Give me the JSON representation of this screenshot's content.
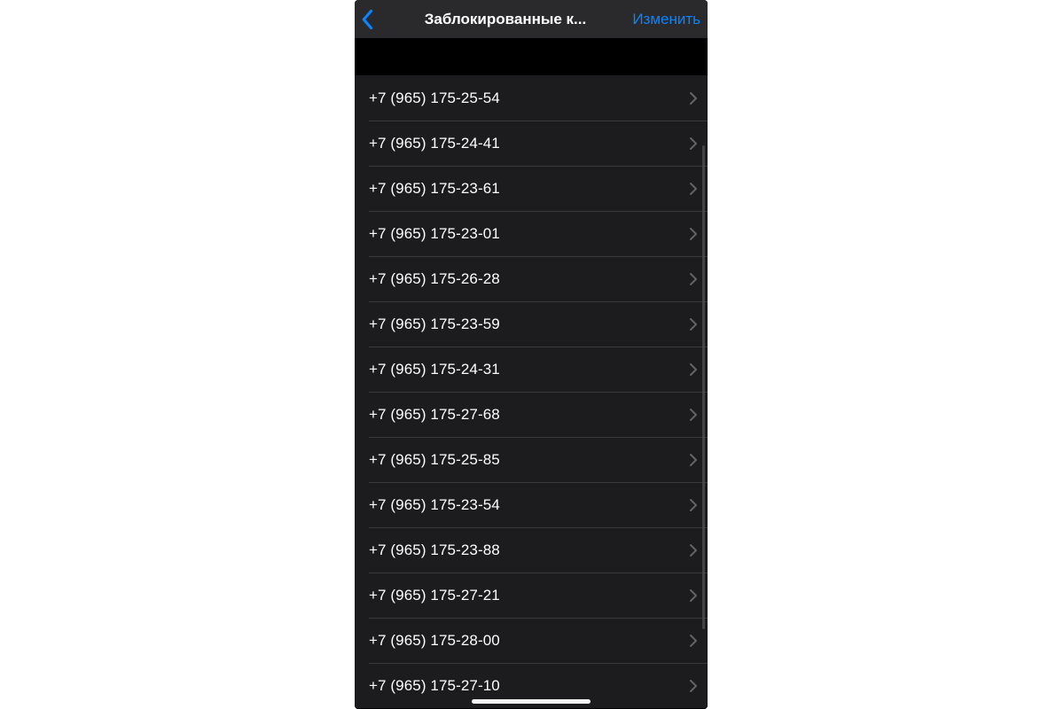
{
  "nav": {
    "title": "Заблокированные к...",
    "edit": "Изменить"
  },
  "contacts": [
    "+7 (965) 175-25-54",
    "+7 (965) 175-24-41",
    "+7 (965) 175-23-61",
    "+7 (965) 175-23-01",
    "+7 (965) 175-26-28",
    "+7 (965) 175-23-59",
    "+7 (965) 175-24-31",
    "+7 (965) 175-27-68",
    "+7 (965) 175-25-85",
    "+7 (965) 175-23-54",
    "+7 (965) 175-23-88",
    "+7 (965) 175-27-21",
    "+7 (965) 175-28-00",
    "+7 (965) 175-27-10"
  ]
}
